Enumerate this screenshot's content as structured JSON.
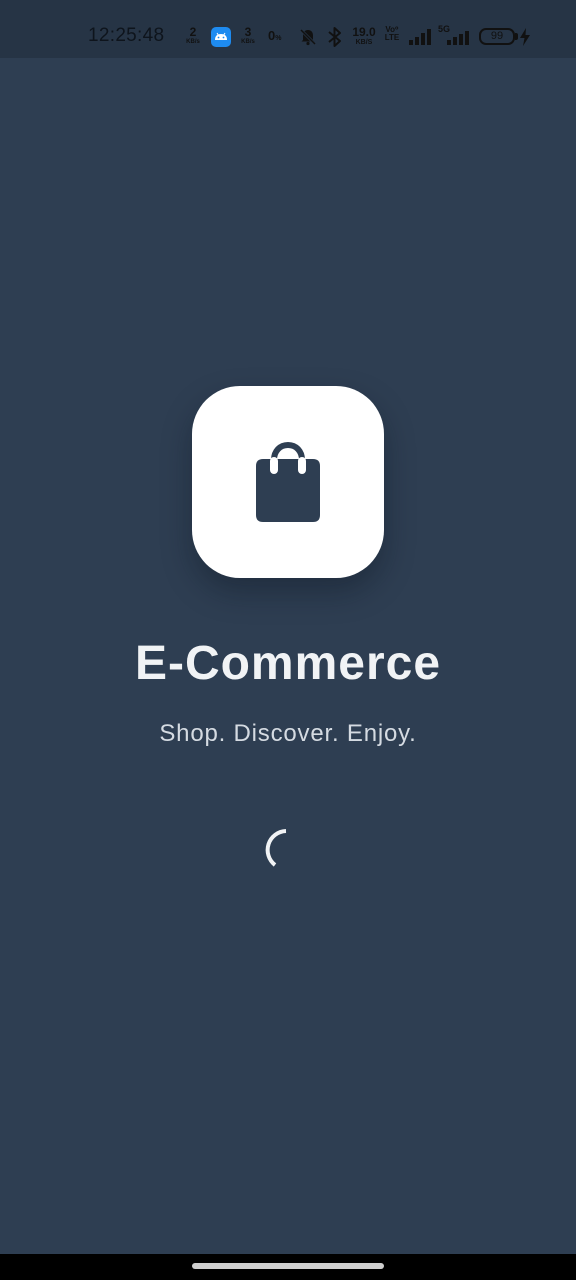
{
  "status_bar": {
    "time": "12:25:48",
    "net_speed_1": {
      "value": "2",
      "unit": "KB/s"
    },
    "net_speed_2": {
      "value": "3",
      "unit": "KB/s"
    },
    "net_speed_3": {
      "value": "0",
      "unit": ""
    },
    "data_speed": {
      "value": "19.0",
      "unit": "KB/S"
    },
    "volte_label": "Vo⁰ LTE",
    "network_label": "5G",
    "battery_level": "99",
    "charging": true
  },
  "splash": {
    "title": "E-Commerce",
    "tagline": "Shop. Discover. Enjoy.",
    "logo_icon": "shopping-bag-icon",
    "loading": true
  },
  "colors": {
    "background": "#2e3e52",
    "status_bar": "#263445",
    "logo_card": "#ffffff",
    "icon": "#2e3e52",
    "title": "#f1f3f5",
    "tagline": "#d5dbe2"
  }
}
